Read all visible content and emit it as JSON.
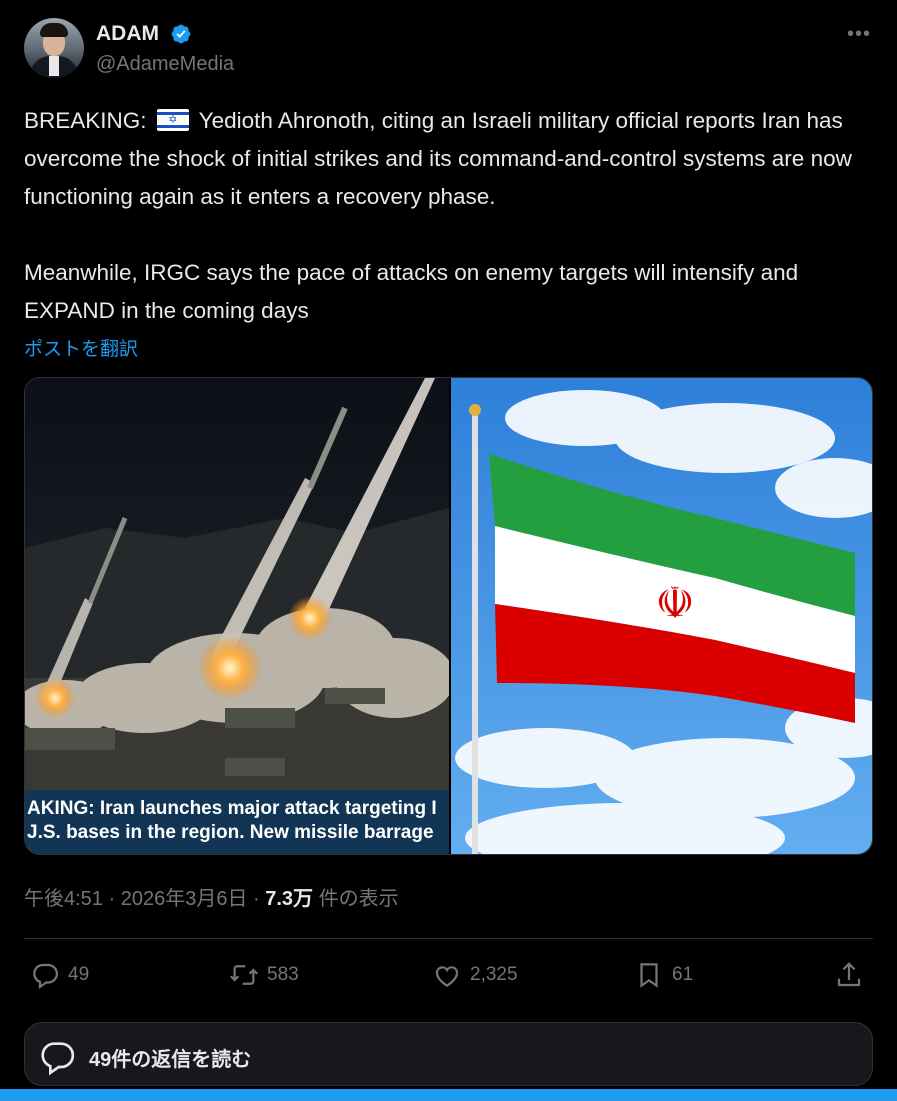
{
  "author": {
    "name": "ADAM",
    "handle": "@AdameMedia",
    "more_label": "•••"
  },
  "tweet": {
    "prefix": "BREAKING: ",
    "flag_emoji": "🇮🇱",
    "text_part1": " Yedioth Ahronoth, citing an Israeli military official reports Iran has overcome the shock of initial strikes and its command-and-control systems are now functioning again as it enters a recovery phase.",
    "text_part2": "Meanwhile, IRGC says the pace of attacks on enemy targets will intensify and EXPAND in the coming days",
    "translate_label": "ポストを翻訳"
  },
  "media": {
    "left_caption_line1": "AKING: Iran launches major attack targeting I",
    "left_caption_line2": "J.S. bases in the region. New missile barrage"
  },
  "meta": {
    "time": "午後4:51",
    "sep1": " · ",
    "date": "2026年3月6日",
    "sep2": " · ",
    "views": "7.3万",
    "views_suffix": " 件の表示"
  },
  "actions": {
    "replies": "49",
    "reposts": "583",
    "likes": "2,325",
    "bookmarks": "61"
  },
  "replies_button_label": "49件の返信を読む",
  "colors": {
    "accent": "#1d9bf0",
    "muted": "#71767b",
    "text": "#e7e9ea",
    "background": "#000000"
  },
  "icons": [
    "verified-badge-icon",
    "more-icon",
    "reply-icon",
    "repost-icon",
    "like-icon",
    "bookmark-icon",
    "share-icon",
    "reply-bubble-icon"
  ]
}
